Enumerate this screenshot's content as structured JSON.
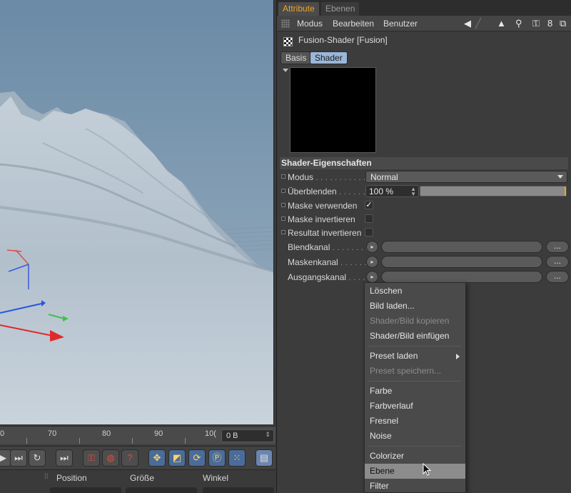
{
  "viewport": {
    "background": "#7f9ab1"
  },
  "timeline": {
    "ticks": [
      "0",
      "70",
      "80",
      "90",
      "10("
    ],
    "frame_value": "0 B"
  },
  "transport": {
    "buttons": [
      "go-end",
      "record-key",
      "auto-key",
      "keyframe-help",
      "move-tool",
      "scale-tool",
      "rotate-tool",
      "parameter-tool",
      "point-tool",
      "film"
    ]
  },
  "coords": {
    "position": "Position",
    "size": "Größe",
    "angle": "Winkel"
  },
  "attribute_manager": {
    "tabs": [
      "Attribute",
      "Ebenen"
    ],
    "menu": [
      "Modus",
      "Bearbeiten",
      "Benutzer"
    ],
    "object_title": "Fusion-Shader [Fusion]",
    "subtabs": [
      "Basis",
      "Shader"
    ],
    "section_title": "Shader-Eigenschaften",
    "rows": {
      "modus": {
        "label": "Modus",
        "dots": " . . . . . . . . . . . .",
        "value": "Normal"
      },
      "ueberblenden": {
        "label": "Überblenden",
        "dots": " . . . . . .",
        "value": "100 %",
        "fill": 1.0
      },
      "maske_verwenden": {
        "label": "Maske verwenden",
        "checked": "✓"
      },
      "maske_invertieren": {
        "label": "Maske invertieren"
      },
      "resultat_invertieren": {
        "label": "Resultat invertieren"
      },
      "blendkanal": {
        "label": "Blendkanal",
        "dots": " . . . . . . . ."
      },
      "maskenkanal": {
        "label": "Maskenkanal",
        "dots": " . . . . . ."
      },
      "ausgangskanal": {
        "label": "Ausgangskanal",
        "dots": " . . . ."
      }
    },
    "ellipsis": "...",
    "link_arrow": "▸"
  },
  "context_menu": {
    "items": [
      {
        "label": "Löschen",
        "state": "normal"
      },
      {
        "label": "Bild laden...",
        "state": "normal"
      },
      {
        "label": "Shader/Bild kopieren",
        "state": "disabled"
      },
      {
        "label": "Shader/Bild einfügen",
        "state": "normal"
      },
      {
        "label": "Preset laden",
        "state": "normal",
        "submenu": true
      },
      {
        "label": "Preset speichern...",
        "state": "disabled"
      },
      {
        "label": "Farbe",
        "state": "normal"
      },
      {
        "label": "Farbverlauf",
        "state": "normal"
      },
      {
        "label": "Fresnel",
        "state": "normal"
      },
      {
        "label": "Noise",
        "state": "normal"
      },
      {
        "label": "Colorizer",
        "state": "normal"
      },
      {
        "label": "Ebene",
        "state": "highlighted"
      },
      {
        "label": "Filter",
        "state": "normal"
      }
    ]
  },
  "colors": {
    "accent": "#f3a321",
    "panel": "#3c3c3c",
    "subtab_active": "#9ab6d8"
  }
}
